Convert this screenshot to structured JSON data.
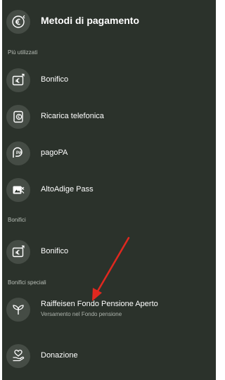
{
  "header": {
    "title": "Metodi di pagamento",
    "icon": "euro-transfer-icon"
  },
  "sections": {
    "most_used": "Più utilizzati",
    "transfers": "Bonifici",
    "special_transfers": "Bonifici speciali"
  },
  "items": {
    "bonifico": {
      "label": "Bonifico",
      "icon": "bank-transfer-icon"
    },
    "ricarica": {
      "label": "Ricarica telefonica",
      "icon": "phone-topup-icon"
    },
    "pagopa": {
      "label": "pagoPA",
      "icon": "pagopa-icon"
    },
    "altoadige": {
      "label": "AltoAdige Pass",
      "icon": "altoadige-pass-icon"
    },
    "bonifico2": {
      "label": "Bonifico",
      "icon": "bank-transfer-icon"
    },
    "raiffeisen": {
      "label": "Raiffeisen Fondo Pensione Aperto",
      "sublabel": "Versamento nel Fondo pensione",
      "icon": "sprout-icon"
    },
    "donazione": {
      "label": "Donazione",
      "icon": "heart-hand-icon"
    }
  },
  "colors": {
    "panel_bg": "#2b322b",
    "icon_bg": "#454c45",
    "text": "#ffffff",
    "section_text": "#b9bfb8",
    "annotation_arrow": "#e0281f"
  }
}
